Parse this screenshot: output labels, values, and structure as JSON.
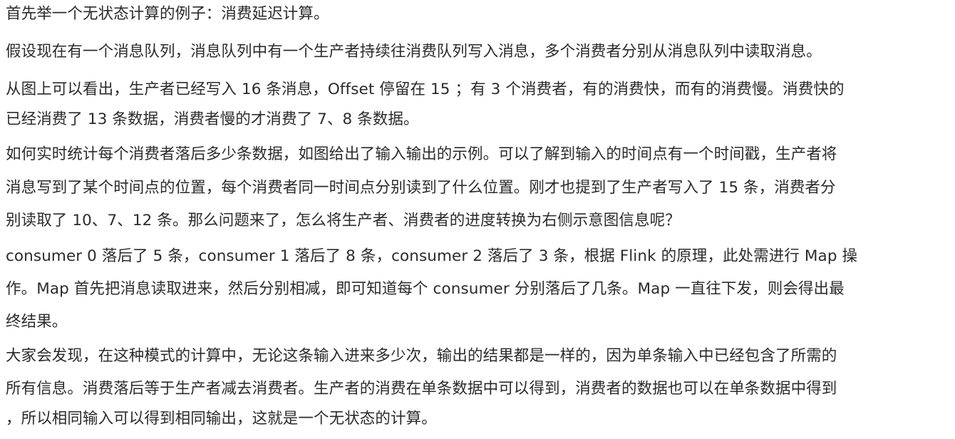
{
  "paragraphs": [
    {
      "lines": [
        "首先举一个无状态计算的例子：消费延迟计算。"
      ]
    },
    {
      "lines": [
        "假设现在有一个消息队列，消息队列中有一个生产者持续往消费队列写入消息，多个消费者分别从消息队列中读取消息。"
      ]
    },
    {
      "lines": [
        "从图上可以看出，生产者已经写入 16 条消息，Offset 停留在 15 ；有 3 个消费者，有的消费快，而有的消费慢。消费快的",
        "已经消费了 13 条数据，消费者慢的才消费了 7、8 条数据。"
      ]
    },
    {
      "lines": [
        "如何实时统计每个消费者落后多少条数据，如图给出了输入输出的示例。可以了解到输入的时间点有一个时间戳，生产者将",
        "消息写到了某个时间点的位置，每个消费者同一时间点分别读到了什么位置。刚才也提到了生产者写入了 15 条，消费者分",
        "别读取了 10、7、12 条。那么问题来了，怎么将生产者、消费者的进度转换为右侧示意图信息呢？"
      ]
    },
    {
      "lines": [
        "consumer 0 落后了 5 条，consumer 1 落后了 8 条，consumer 2 落后了 3 条，根据 Flink 的原理，此处需进行 Map 操",
        "作。Map 首先把消息读取进来，然后分别相减，即可知道每个 consumer 分别落后了几条。Map 一直往下发，则会得出最",
        "终结果。"
      ]
    },
    {
      "lines": [
        "大家会发现，在这种模式的计算中，无论这条输入进来多少次，输出的结果都是一样的，因为单条输入中已经包含了所需的",
        "所有信息。消费落后等于生产者减去消费者。生产者的消费在单条数据中可以得到，消费者的数据也可以在单条数据中得到",
        "，所以相同输入可以得到相同输出，这就是一个无状态的计算。"
      ]
    }
  ]
}
